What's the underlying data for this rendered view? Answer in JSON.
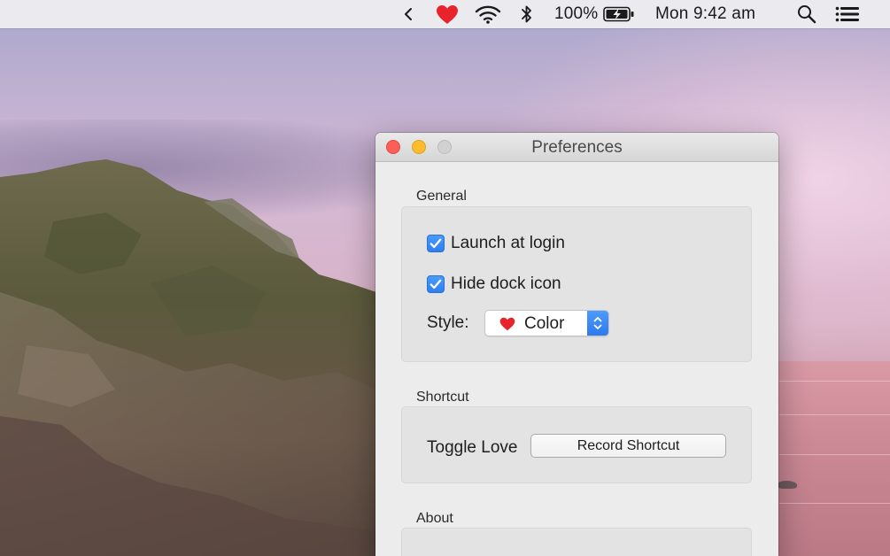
{
  "menubar": {
    "items": [
      {
        "id": "collapse",
        "icon": "chevron-left-icon"
      },
      {
        "id": "love",
        "icon": "heart-icon",
        "color": "#e8232c"
      },
      {
        "id": "wifi",
        "icon": "wifi-icon"
      },
      {
        "id": "bluetooth",
        "icon": "bluetooth-icon"
      },
      {
        "id": "battery",
        "label": "100%",
        "icon": "battery-charging-icon"
      },
      {
        "id": "clock",
        "label": "Mon 9:42 am"
      },
      {
        "id": "spotlight",
        "icon": "search-icon"
      },
      {
        "id": "notification-center",
        "icon": "list-icon"
      }
    ]
  },
  "window": {
    "title": "Preferences",
    "sections": {
      "general": {
        "label": "General",
        "launch_at_login": {
          "label": "Launch at login",
          "checked": true
        },
        "hide_dock_icon": {
          "label": "Hide dock icon",
          "checked": true
        },
        "style": {
          "label": "Style:",
          "value": "Color",
          "icon": "heart-icon"
        }
      },
      "shortcut": {
        "label": "Shortcut",
        "toggle_label": "Toggle Love",
        "record_button": "Record Shortcut"
      },
      "about": {
        "label": "About"
      }
    }
  },
  "colors": {
    "accent": "#2f7ef0",
    "heart": "#e8232c",
    "close": "#fc5f57",
    "minimize": "#fdbc2e",
    "zoom_disabled": "#d1d1d1"
  }
}
